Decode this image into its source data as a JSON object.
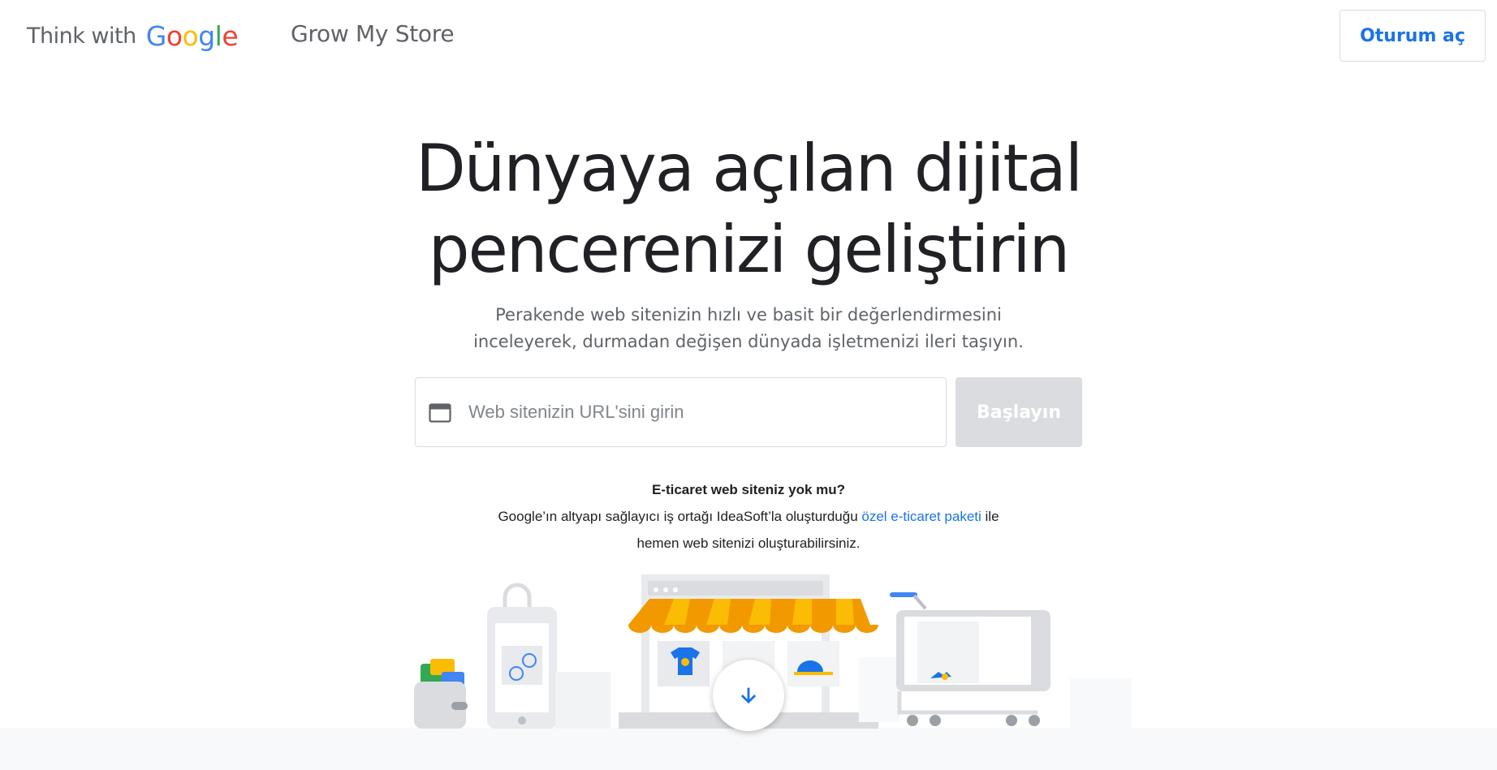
{
  "header": {
    "brand_think": "Think with",
    "brand_google": [
      "G",
      "o",
      "o",
      "g",
      "l",
      "e"
    ],
    "product_name": "Grow My Store",
    "signin_label": "Oturum aç"
  },
  "hero": {
    "title_line1": "Dünyaya açılan dijital",
    "title_line2": "pencerenizi geliştirin",
    "subtitle_line1": "Perakende web sitenizin hızlı ve basit bir değerlendirmesini",
    "subtitle_line2": "inceleyerek, durmadan değişen dünyada işletmenizi ileri taşıyın."
  },
  "search": {
    "placeholder": "Web sitenizin URL'sini girin",
    "value": "",
    "button_label": "Başlayın"
  },
  "no_site": {
    "question": "E-ticaret web siteniz yok mu?",
    "line1_before": "Google’ın altyapı sağlayıcı iş ortağı IdeaSoft’la oluşturduğu ",
    "line1_link": "özel e-ticaret paketi",
    "line1_after": " ile",
    "line2": "hemen web sitenizi oluşturabilirsiniz."
  },
  "colors": {
    "google_blue": "#4285f4",
    "google_red": "#ea4335",
    "google_yellow": "#fbbc05",
    "google_green": "#34a853",
    "link": "#1a73e8",
    "awning_orange": "#f29900",
    "awning_yellow": "#fbbc04"
  },
  "icons": {
    "browser": "browser-window-icon",
    "scroll": "arrow-down-icon"
  }
}
